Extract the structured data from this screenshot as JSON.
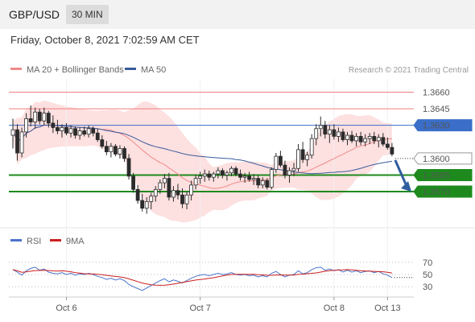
{
  "header": {
    "pair": "GBP/USD",
    "timeframe": "30 MIN"
  },
  "datetime": "Friday, October 8, 2021 7:02:59 AM CET",
  "legend": {
    "ma": "MA 20 + Bollinger Bands",
    "ma50": "MA 50"
  },
  "credit": "Research © 2021 Trading Central",
  "rsi_legend": {
    "rsi": "RSI",
    "ma9": "9MA"
  },
  "colors": {
    "resistance": "#f07f7f",
    "pivot": "#3a6ec8",
    "support": "#1e8a1e",
    "candle_up": "#2b2b2b",
    "candle_down": "#2b2b2b",
    "band_fill": "#fde0e0",
    "ma20": "#f08a8a",
    "ma50": "#3a5b9c",
    "rsi": "#4a73c9",
    "rsi_ma": "#cc1f1f",
    "arrow": "#2f5d9e"
  },
  "chart_data": {
    "type": "candlestick",
    "y_range": [
      1.3538,
      1.3672
    ],
    "levels": [
      {
        "label": "1.3660",
        "value": 1.366,
        "kind": "resistance"
      },
      {
        "label": "1.3645",
        "value": 1.3645,
        "kind": "resistance"
      },
      {
        "label": "1.3630",
        "value": 1.363,
        "kind": "pivot"
      },
      {
        "label": "1.3600",
        "value": 1.36,
        "kind": "last"
      },
      {
        "label": "1.3585",
        "value": 1.3585,
        "kind": "support"
      },
      {
        "label": "1.3570",
        "value": 1.357,
        "kind": "support"
      }
    ],
    "candles": [
      [
        1.3621,
        1.3636,
        1.3609,
        1.3626
      ],
      [
        1.3626,
        1.3631,
        1.3598,
        1.3605
      ],
      [
        1.3605,
        1.3628,
        1.3601,
        1.3624
      ],
      [
        1.3624,
        1.3641,
        1.3619,
        1.3636
      ],
      [
        1.3636,
        1.3648,
        1.3629,
        1.3633
      ],
      [
        1.3633,
        1.3646,
        1.3627,
        1.3642
      ],
      [
        1.3642,
        1.3645,
        1.3631,
        1.3634
      ],
      [
        1.3634,
        1.3646,
        1.363,
        1.3641
      ],
      [
        1.3641,
        1.3643,
        1.3628,
        1.3632
      ],
      [
        1.3632,
        1.3639,
        1.3623,
        1.3628
      ],
      [
        1.3628,
        1.3635,
        1.3622,
        1.3625
      ],
      [
        1.3625,
        1.3631,
        1.3619,
        1.3628
      ],
      [
        1.3628,
        1.3632,
        1.3621,
        1.3623
      ],
      [
        1.3623,
        1.363,
        1.3619,
        1.3627
      ],
      [
        1.3627,
        1.3629,
        1.3618,
        1.3621
      ],
      [
        1.3621,
        1.3628,
        1.3617,
        1.3625
      ],
      [
        1.3625,
        1.3629,
        1.362,
        1.3622
      ],
      [
        1.3622,
        1.363,
        1.3619,
        1.3627
      ],
      [
        1.3627,
        1.3629,
        1.362,
        1.3623
      ],
      [
        1.3623,
        1.3627,
        1.3615,
        1.3617
      ],
      [
        1.3617,
        1.3621,
        1.3609,
        1.3611
      ],
      [
        1.3611,
        1.3616,
        1.3603,
        1.3606
      ],
      [
        1.3606,
        1.3614,
        1.3601,
        1.3611
      ],
      [
        1.3611,
        1.3613,
        1.3602,
        1.3604
      ],
      [
        1.3604,
        1.3612,
        1.36,
        1.3609
      ],
      [
        1.3609,
        1.3611,
        1.3597,
        1.36
      ],
      [
        1.36,
        1.3604,
        1.3581,
        1.3584
      ],
      [
        1.3584,
        1.3587,
        1.3569,
        1.3572
      ],
      [
        1.3572,
        1.3576,
        1.3559,
        1.3562
      ],
      [
        1.3562,
        1.3568,
        1.3552,
        1.3555
      ],
      [
        1.3555,
        1.3565,
        1.355,
        1.3561
      ],
      [
        1.3561,
        1.3569,
        1.3554,
        1.3566
      ],
      [
        1.3566,
        1.3575,
        1.3561,
        1.3572
      ],
      [
        1.3572,
        1.3581,
        1.3568,
        1.3578
      ],
      [
        1.3578,
        1.3586,
        1.3573,
        1.3582
      ],
      [
        1.3582,
        1.3587,
        1.3562,
        1.3565
      ],
      [
        1.3565,
        1.3575,
        1.3561,
        1.3571
      ],
      [
        1.3571,
        1.3577,
        1.3563,
        1.3567
      ],
      [
        1.3567,
        1.3573,
        1.3555,
        1.3559
      ],
      [
        1.3559,
        1.357,
        1.3554,
        1.3567
      ],
      [
        1.3567,
        1.358,
        1.3562,
        1.3576
      ],
      [
        1.3576,
        1.3585,
        1.3572,
        1.3582
      ],
      [
        1.3582,
        1.3588,
        1.3577,
        1.3584
      ],
      [
        1.3584,
        1.359,
        1.3579,
        1.3586
      ],
      [
        1.3586,
        1.3589,
        1.358,
        1.3583
      ],
      [
        1.3583,
        1.3588,
        1.3579,
        1.3586
      ],
      [
        1.3586,
        1.3592,
        1.3582,
        1.3589
      ],
      [
        1.3589,
        1.3591,
        1.3582,
        1.3585
      ],
      [
        1.3585,
        1.3589,
        1.358,
        1.3587
      ],
      [
        1.3587,
        1.3593,
        1.3584,
        1.3591
      ],
      [
        1.3591,
        1.3593,
        1.3584,
        1.3586
      ],
      [
        1.3586,
        1.359,
        1.358,
        1.3583
      ],
      [
        1.3583,
        1.3587,
        1.3578,
        1.3584
      ],
      [
        1.3584,
        1.3588,
        1.3579,
        1.3581
      ],
      [
        1.3581,
        1.3586,
        1.3576,
        1.3582
      ],
      [
        1.3582,
        1.3585,
        1.3573,
        1.3576
      ],
      [
        1.3576,
        1.3583,
        1.3573,
        1.358
      ],
      [
        1.358,
        1.3582,
        1.3572,
        1.3574
      ],
      [
        1.3574,
        1.3592,
        1.3572,
        1.359
      ],
      [
        1.359,
        1.3605,
        1.3587,
        1.3602
      ],
      [
        1.3602,
        1.3607,
        1.3592,
        1.3594
      ],
      [
        1.3594,
        1.3598,
        1.3582,
        1.3585
      ],
      [
        1.3585,
        1.3592,
        1.3578,
        1.3589
      ],
      [
        1.3589,
        1.3596,
        1.3584,
        1.3591
      ],
      [
        1.3591,
        1.3613,
        1.3588,
        1.3608
      ],
      [
        1.3608,
        1.3615,
        1.3596,
        1.3599
      ],
      [
        1.3599,
        1.3606,
        1.3593,
        1.3603
      ],
      [
        1.3603,
        1.3622,
        1.36,
        1.3618
      ],
      [
        1.3618,
        1.3631,
        1.3612,
        1.3627
      ],
      [
        1.3627,
        1.3638,
        1.362,
        1.363
      ],
      [
        1.363,
        1.3634,
        1.3618,
        1.3622
      ],
      [
        1.3622,
        1.363,
        1.3614,
        1.3626
      ],
      [
        1.3626,
        1.3631,
        1.3617,
        1.362
      ],
      [
        1.362,
        1.3628,
        1.3615,
        1.3624
      ],
      [
        1.3624,
        1.3627,
        1.3615,
        1.3617
      ],
      [
        1.3617,
        1.3624,
        1.3612,
        1.3621
      ],
      [
        1.3621,
        1.3625,
        1.3614,
        1.3616
      ],
      [
        1.3616,
        1.3623,
        1.3611,
        1.362
      ],
      [
        1.362,
        1.3624,
        1.3612,
        1.3615
      ],
      [
        1.3615,
        1.3622,
        1.3611,
        1.3618
      ],
      [
        1.3618,
        1.3623,
        1.3613,
        1.362
      ],
      [
        1.362,
        1.3624,
        1.3613,
        1.3616
      ],
      [
        1.3616,
        1.3622,
        1.361,
        1.3619
      ],
      [
        1.3619,
        1.3623,
        1.3611,
        1.3613
      ],
      [
        1.3613,
        1.3619,
        1.3608,
        1.361
      ],
      [
        1.361,
        1.3614,
        1.3602,
        1.3604
      ]
    ],
    "rsi": [
      58,
      54,
      49,
      56,
      60,
      62,
      57,
      59,
      54,
      52,
      51,
      53,
      50,
      52,
      49,
      51,
      50,
      52,
      50,
      47,
      45,
      42,
      44,
      41,
      43,
      40,
      34,
      30,
      27,
      24,
      28,
      32,
      36,
      40,
      43,
      38,
      41,
      39,
      36,
      40,
      44,
      47,
      49,
      50,
      48,
      50,
      52,
      50,
      51,
      53,
      50,
      49,
      50,
      48,
      49,
      46,
      48,
      46,
      52,
      55,
      50,
      46,
      49,
      50,
      56,
      51,
      53,
      58,
      61,
      62,
      57,
      59,
      56,
      58,
      54,
      57,
      54,
      56,
      53,
      55,
      56,
      53,
      55,
      51,
      49,
      45
    ],
    "rsi_ticks": [
      {
        "label": "70",
        "value": 70
      },
      {
        "label": "50",
        "value": 50
      },
      {
        "label": "30",
        "value": 30
      }
    ],
    "x_ticks": [
      {
        "label": "Oct 6",
        "index": 12
      },
      {
        "label": "Oct 7",
        "index": 42
      },
      {
        "label": "Oct 8",
        "index": 72
      },
      {
        "label": "Oct 13",
        "index": 84
      }
    ]
  }
}
